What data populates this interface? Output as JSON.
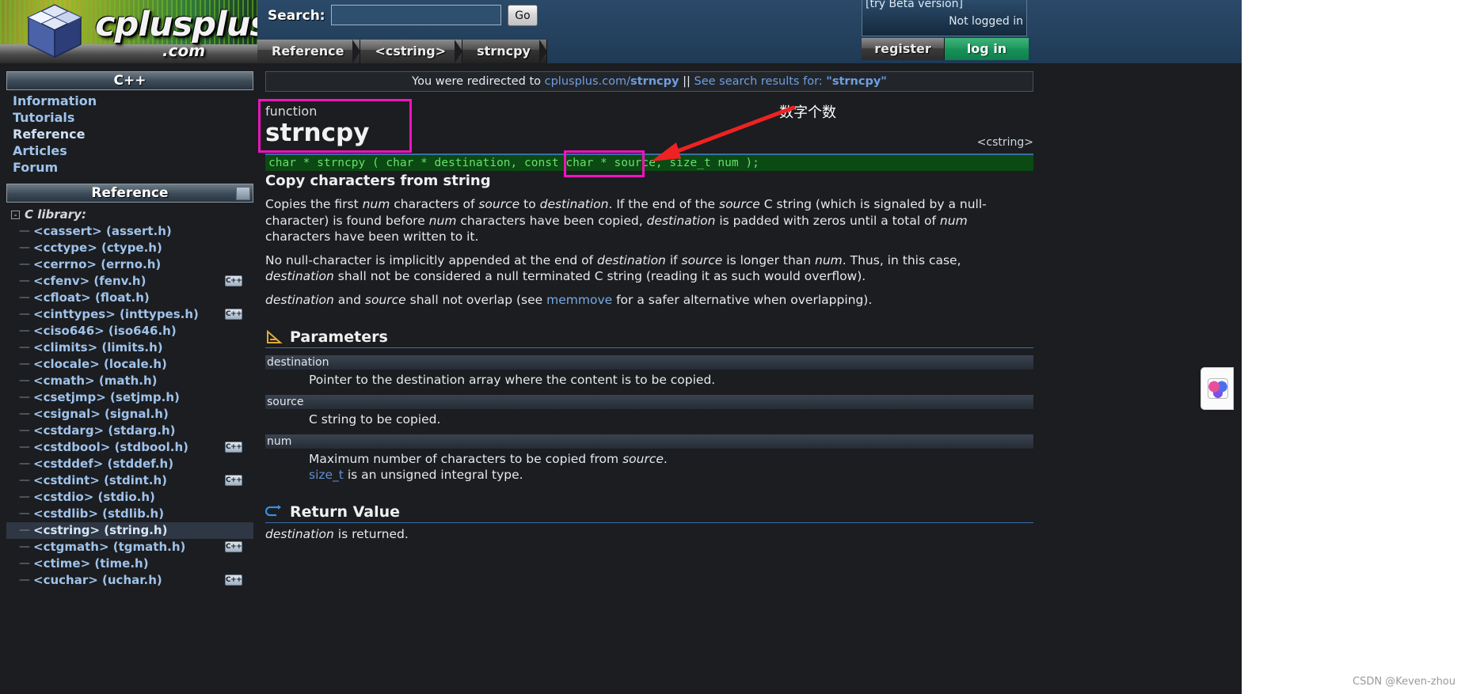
{
  "header": {
    "logo_text": "cplusplus",
    "logo_suffix": ".com",
    "search_label": "Search:",
    "search_value": "",
    "search_placeholder": "",
    "go_label": "Go",
    "beta_text": "[try Beta version]",
    "login_status": "Not logged in",
    "register_label": "register",
    "login_label": "log in",
    "breadcrumbs": [
      {
        "label": "Reference",
        "selected": false
      },
      {
        "label": "<cstring>",
        "selected": false
      },
      {
        "label": "strncpy",
        "selected": true
      }
    ]
  },
  "sidebar": {
    "title": "C++",
    "nav": [
      {
        "label": "Information",
        "current": false
      },
      {
        "label": "Tutorials",
        "current": false
      },
      {
        "label": "Reference",
        "current": true
      },
      {
        "label": "Articles",
        "current": false
      },
      {
        "label": "Forum",
        "current": false
      }
    ],
    "reference_title": "Reference",
    "tree_root": "C library:",
    "tree_toggle": "-",
    "tree_items": [
      {
        "label": "<cassert> (assert.h)",
        "cpp11": false,
        "active": false
      },
      {
        "label": "<cctype> (ctype.h)",
        "cpp11": false,
        "active": false
      },
      {
        "label": "<cerrno> (errno.h)",
        "cpp11": false,
        "active": false
      },
      {
        "label": "<cfenv> (fenv.h)",
        "cpp11": true,
        "active": false
      },
      {
        "label": "<cfloat> (float.h)",
        "cpp11": false,
        "active": false
      },
      {
        "label": "<cinttypes> (inttypes.h)",
        "cpp11": true,
        "active": false
      },
      {
        "label": "<ciso646> (iso646.h)",
        "cpp11": false,
        "active": false
      },
      {
        "label": "<climits> (limits.h)",
        "cpp11": false,
        "active": false
      },
      {
        "label": "<clocale> (locale.h)",
        "cpp11": false,
        "active": false
      },
      {
        "label": "<cmath> (math.h)",
        "cpp11": false,
        "active": false
      },
      {
        "label": "<csetjmp> (setjmp.h)",
        "cpp11": false,
        "active": false
      },
      {
        "label": "<csignal> (signal.h)",
        "cpp11": false,
        "active": false
      },
      {
        "label": "<cstdarg> (stdarg.h)",
        "cpp11": false,
        "active": false
      },
      {
        "label": "<cstdbool> (stdbool.h)",
        "cpp11": true,
        "active": false
      },
      {
        "label": "<cstddef> (stddef.h)",
        "cpp11": false,
        "active": false
      },
      {
        "label": "<cstdint> (stdint.h)",
        "cpp11": true,
        "active": false
      },
      {
        "label": "<cstdio> (stdio.h)",
        "cpp11": false,
        "active": false
      },
      {
        "label": "<cstdlib> (stdlib.h)",
        "cpp11": false,
        "active": false
      },
      {
        "label": "<cstring> (string.h)",
        "cpp11": false,
        "active": true
      },
      {
        "label": "<ctgmath> (tgmath.h)",
        "cpp11": true,
        "active": false
      },
      {
        "label": "<ctime> (time.h)",
        "cpp11": false,
        "active": false
      },
      {
        "label": "<cuchar> (uchar.h)",
        "cpp11": true,
        "active": false
      }
    ],
    "cpp11_badge": "C++11"
  },
  "main": {
    "redirect": {
      "prefix": "You were redirected to ",
      "link_plain": "cplusplus.com/",
      "link_bold": "strncpy",
      "separator": " || ",
      "search_prefix": "See search results for: ",
      "search_term": "\"strncpy\""
    },
    "function_kind": "function",
    "function_name": "strncpy",
    "header_file": "<cstring>",
    "prototype": "char * strncpy ( char * destination, const char * source, size_t num );",
    "summary": "Copy characters from string",
    "paragraphs": [
      "Copies the first num characters of source to destination. If the end of the source C string (which is signaled by a null-character) is found before num characters have been copied, destination is padded with zeros until a total of num characters have been written to it.",
      "No null-character is implicitly appended at the end of destination if source is longer than num. Thus, in this case, destination shall not be considered a null terminated C string (reading it as such would overflow).",
      "destination and source shall not overlap (see memmove for a safer alternative when overlapping)."
    ],
    "parameters_heading": "Parameters",
    "parameters": [
      {
        "name": "destination",
        "desc": "Pointer to the destination array where the content is to be copied."
      },
      {
        "name": "source",
        "desc": "C string to be copied."
      },
      {
        "name": "num",
        "desc": "Maximum number of characters to be copied from source.",
        "desc2_link": "size_t",
        "desc2": " is an unsigned integral type."
      }
    ],
    "return_heading": "Return Value",
    "return_text": "destination is returned."
  },
  "annotations": {
    "chinese_note": "数字个数",
    "highlight_color": "#f012be",
    "arrow_color": "#ee2222"
  },
  "watermark": "CSDN @Keven-zhou"
}
